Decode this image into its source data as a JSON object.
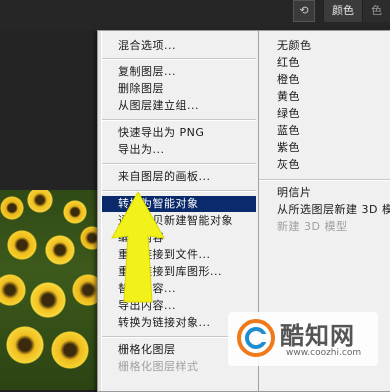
{
  "topbar": {
    "tab_color": "颜色",
    "tab_swatches": "色",
    "icon": "rotate-icon"
  },
  "menu": {
    "left": [
      {
        "label": "混合选项...",
        "state": "normal"
      },
      {
        "label": "复制图层...",
        "state": "normal"
      },
      {
        "label": "删除图层",
        "state": "normal"
      },
      {
        "label": "从图层建立组...",
        "state": "normal"
      },
      {
        "label": "快速导出为 PNG",
        "state": "normal"
      },
      {
        "label": "导出为...",
        "state": "normal"
      },
      {
        "label": "来自图层的画板...",
        "state": "normal"
      },
      {
        "label": "转换为智能对象",
        "state": "highlighted"
      },
      {
        "label": "通过拷贝新建智能对象",
        "state": "normal"
      },
      {
        "label": "编辑内容",
        "state": "normal"
      },
      {
        "label": "重新链接到文件...",
        "state": "normal"
      },
      {
        "label": "重新链接到库图形...",
        "state": "normal"
      },
      {
        "label": "替换内容...",
        "state": "normal"
      },
      {
        "label": "导出内容...",
        "state": "normal"
      },
      {
        "label": "转换为链接对象...",
        "state": "normal"
      },
      {
        "label": "栅格化图层",
        "state": "normal"
      },
      {
        "label": "栅格化图层样式",
        "state": "disabled"
      }
    ],
    "right": [
      {
        "label": "无颜色",
        "state": "normal"
      },
      {
        "label": "红色",
        "state": "normal"
      },
      {
        "label": "橙色",
        "state": "normal"
      },
      {
        "label": "黄色",
        "state": "normal"
      },
      {
        "label": "绿色",
        "state": "normal"
      },
      {
        "label": "蓝色",
        "state": "normal"
      },
      {
        "label": "紫色",
        "state": "normal"
      },
      {
        "label": "灰色",
        "state": "normal"
      },
      {
        "label": "明信片",
        "state": "normal"
      },
      {
        "label": "从所选图层新建 3D 模",
        "state": "normal"
      },
      {
        "label": "新建 3D 模型",
        "state": "disabled"
      }
    ]
  },
  "watermark": {
    "name": "酷知网",
    "url": "www.coozhi.com"
  },
  "colors": {
    "highlight": "#0a2a6b",
    "arrow": "#f2f21a"
  }
}
